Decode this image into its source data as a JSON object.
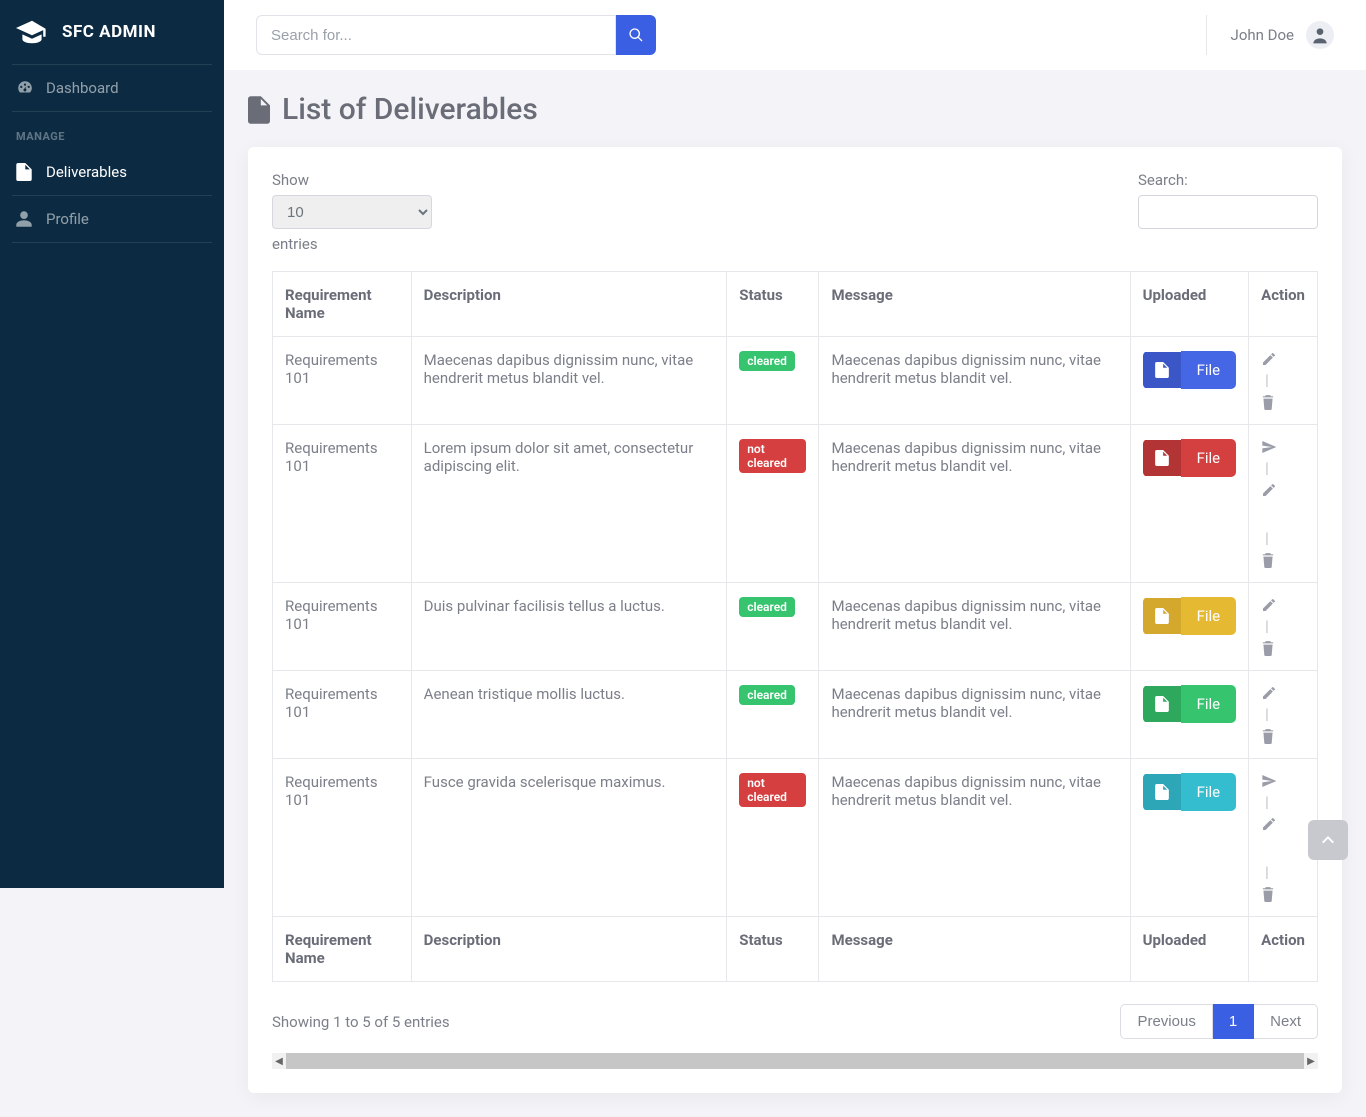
{
  "brand": "SFC ADMIN",
  "sidebar": {
    "items": [
      {
        "label": "Dashboard",
        "active": false
      },
      {
        "label": "Deliverables",
        "active": true
      },
      {
        "label": "Profile",
        "active": false
      }
    ],
    "heading_manage": "MANAGE"
  },
  "topbar": {
    "search_placeholder": "Search for...",
    "username": "John Doe"
  },
  "page": {
    "title": "List of Deliverables"
  },
  "datatable": {
    "show_label": "Show",
    "entries_suffix": "entries",
    "length_value": "10",
    "search_label": "Search:",
    "columns": [
      "Requirement Name",
      "Description",
      "Status",
      "Message",
      "Uploaded",
      "Action"
    ],
    "file_button_label": "File",
    "rows": [
      {
        "name": "Requirements 101",
        "description": "Maecenas dapibus dignissim nunc, vitae hendrerit metus blandit vel.",
        "status": "cleared",
        "status_label": "cleared",
        "message": "Maecenas dapibus dignissim nunc, vitae hendrerit metus blandit vel.",
        "file_variant": "primary",
        "actions": [
          "edit",
          "delete"
        ]
      },
      {
        "name": "Requirements 101",
        "description": "Lorem ipsum dolor sit amet, consectetur adipiscing elit.",
        "status": "not-cleared",
        "status_label": "not cleared",
        "message": "Maecenas dapibus dignissim nunc, vitae hendrerit metus blandit vel.",
        "file_variant": "danger",
        "actions": [
          "send",
          "edit",
          "delete"
        ]
      },
      {
        "name": "Requirements 101",
        "description": "Duis pulvinar facilisis tellus a luctus.",
        "status": "cleared",
        "status_label": "cleared",
        "message": "Maecenas dapibus dignissim nunc, vitae hendrerit metus blandit vel.",
        "file_variant": "warning",
        "actions": [
          "edit",
          "delete"
        ]
      },
      {
        "name": "Requirements 101",
        "description": "Aenean tristique mollis luctus.",
        "status": "cleared",
        "status_label": "cleared",
        "message": "Maecenas dapibus dignissim nunc, vitae hendrerit metus blandit vel.",
        "file_variant": "success",
        "actions": [
          "edit",
          "delete"
        ]
      },
      {
        "name": "Requirements 101",
        "description": "Fusce gravida scelerisque maximus.",
        "status": "not-cleared",
        "status_label": "not cleared",
        "message": "Maecenas dapibus dignissim nunc, vitae hendrerit metus blandit vel.",
        "file_variant": "info",
        "actions": [
          "send",
          "edit",
          "delete"
        ]
      }
    ],
    "info_text": "Showing 1 to 5 of 5 entries",
    "pagination": {
      "previous": "Previous",
      "next": "Next",
      "pages": [
        "1"
      ],
      "active": "1"
    }
  }
}
